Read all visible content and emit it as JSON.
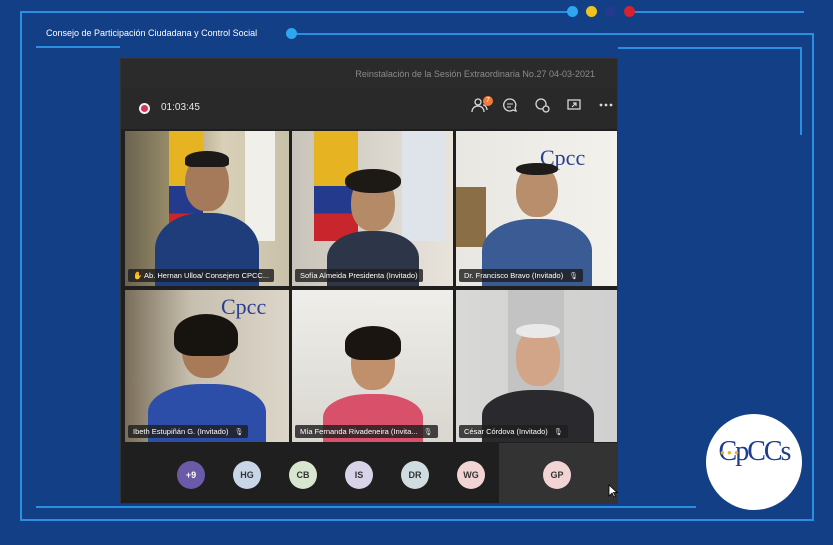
{
  "banner": {
    "org_title": "Consejo de Participación Ciudadana y Control Social",
    "dots": [
      "#2fa6f0",
      "#f2c31b",
      "#243a8c",
      "#d9202f"
    ],
    "accent_line": "#2a8fe0"
  },
  "window": {
    "title": "Reinstalación de la Sesión Extraordinaria No.27 04-03-2021"
  },
  "toolbar": {
    "timer": "01:03:45",
    "participants_badge": "7",
    "icons": [
      "participants-icon",
      "chat-icon",
      "reactions-icon",
      "share-icon",
      "more-icon"
    ]
  },
  "participants": [
    {
      "name": "Ab. Hernan Ulloa/ Consejero CPCC...",
      "hand": "✋"
    },
    {
      "name": "Sofía Almeida Presidenta (Invitado)",
      "mic": ""
    },
    {
      "name": "Dr. Francisco Bravo (Invitado)",
      "mic": "🎙"
    },
    {
      "name": "Ibeth Estupiñán G. (Invitado)",
      "mic": "🎙"
    },
    {
      "name": "Mía Fernanda Rivadeneira (Invita...",
      "mic": "🎙"
    },
    {
      "name": "César Córdova (Invitado)",
      "mic": "🎙"
    }
  ],
  "avatars": [
    {
      "initials": "+9",
      "color": "#6a5aa8"
    },
    {
      "initials": "HG",
      "color": "#c9d6e8"
    },
    {
      "initials": "CB",
      "color": "#d8e5cf"
    },
    {
      "initials": "IS",
      "color": "#d9d3ea"
    },
    {
      "initials": "DR",
      "color": "#cfdde0"
    },
    {
      "initials": "WG",
      "color": "#f3d4d4"
    },
    {
      "initials": "GP",
      "color": "#f3d4d4"
    }
  ],
  "logo": {
    "text": "CpCCs"
  }
}
